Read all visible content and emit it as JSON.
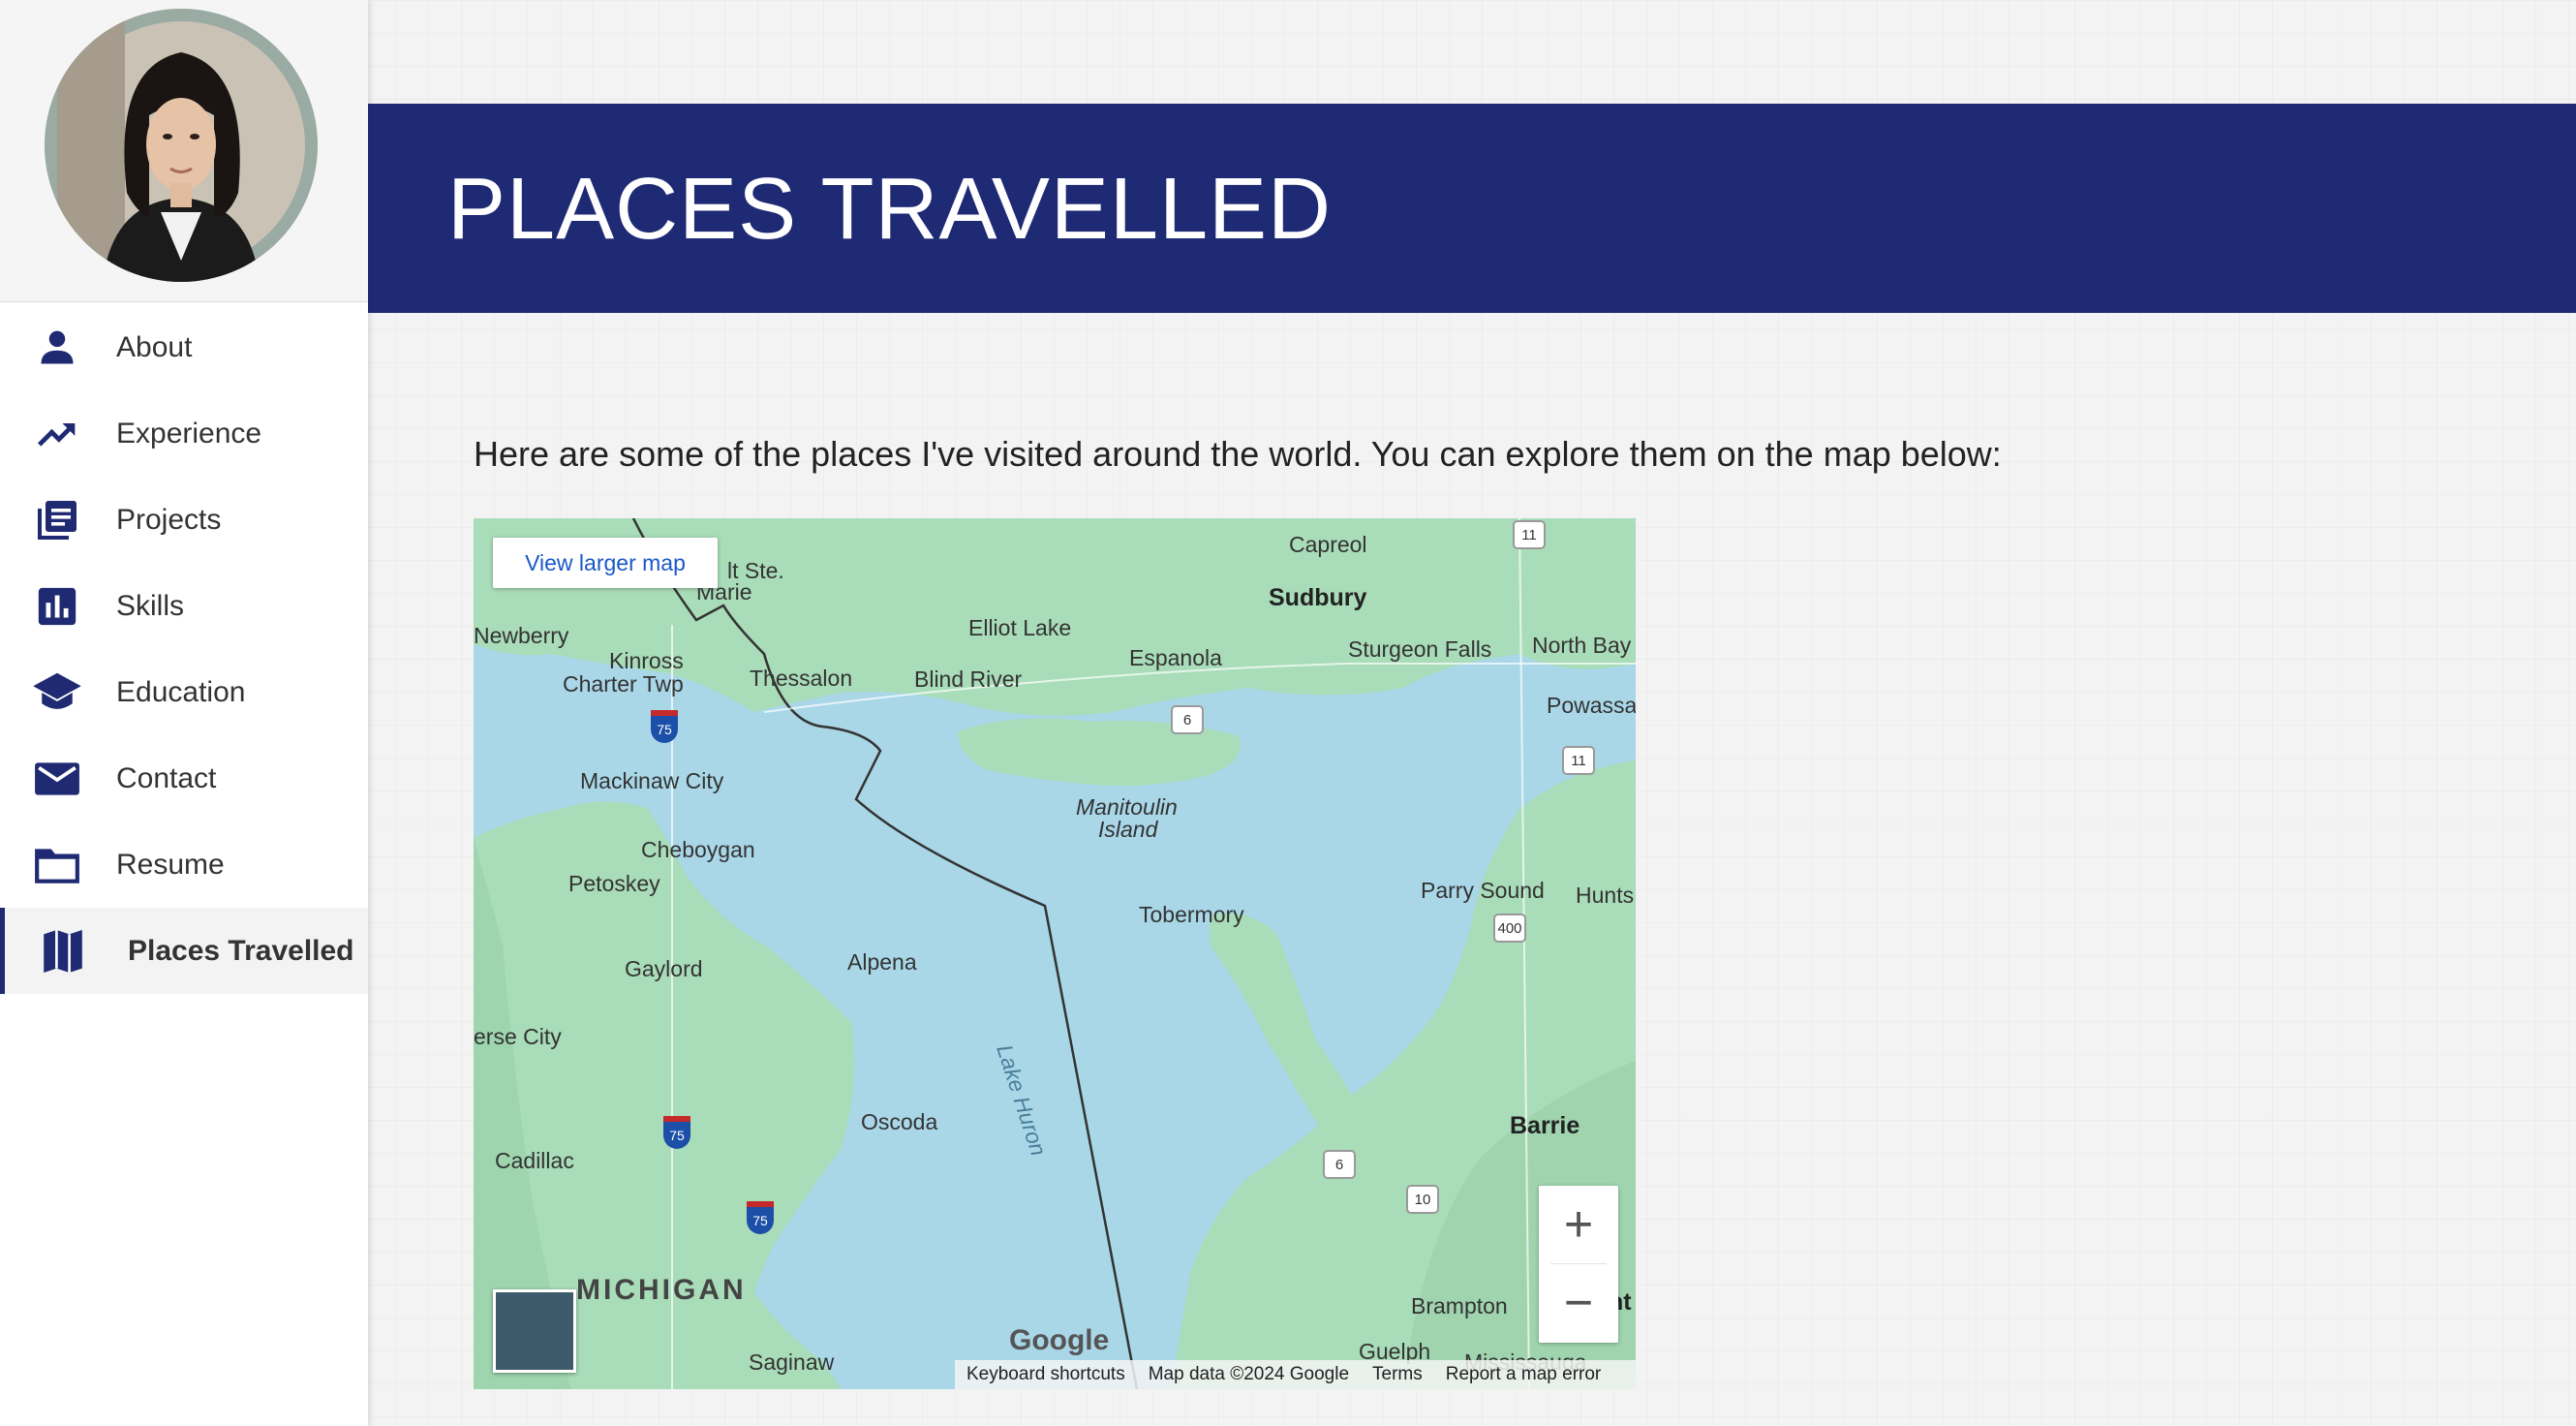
{
  "header": {
    "title": "PLACES TRAVELLED"
  },
  "sidebar": {
    "items": [
      {
        "label": "About",
        "icon": "person-icon"
      },
      {
        "label": "Experience",
        "icon": "trending-up-icon"
      },
      {
        "label": "Projects",
        "icon": "document-stack-icon"
      },
      {
        "label": "Skills",
        "icon": "bar-chart-icon"
      },
      {
        "label": "Education",
        "icon": "graduation-cap-icon"
      },
      {
        "label": "Contact",
        "icon": "mail-icon"
      },
      {
        "label": "Resume",
        "icon": "folder-icon"
      },
      {
        "label": "Places Travelled",
        "icon": "map-icon"
      }
    ],
    "active_index": 7
  },
  "main": {
    "intro": "Here are some of the places I've visited around the world. You can explore them on the map below:"
  },
  "map": {
    "larger_map_label": "View larger map",
    "google_label": "Google",
    "zoom_in": "+",
    "zoom_out": "−",
    "footer": {
      "shortcuts": "Keyboard shortcuts",
      "data": "Map data ©2024 Google",
      "terms": "Terms",
      "report": "Report a map error"
    },
    "labels": {
      "capreol": "Capreol",
      "sudbury": "Sudbury",
      "sault": "lt Ste.",
      "marie": "Marie",
      "newberry": "Newberry",
      "elliot": "Elliot Lake",
      "espanola": "Espanola",
      "north_bay": "North Bay",
      "sturgeon": "Sturgeon Falls",
      "kinross": "Kinross",
      "kinross2": "Charter Twp",
      "thessalon": "Thessalon",
      "blind": "Blind River",
      "powassan": "Powassa",
      "mackinaw": "Mackinaw City",
      "manitoulin": "Manitoulin",
      "island": "Island",
      "cheboygan": "Cheboygan",
      "petoskey": "Petoskey",
      "tobermory": "Tobermory",
      "parry": "Parry Sound",
      "hunts": "Hunts",
      "gaylord": "Gaylord",
      "alpena": "Alpena",
      "traverse": "erse City",
      "lake_huron": "Lake Huron",
      "oscoda": "Oscoda",
      "barrie": "Barrie",
      "cadillac": "Cadillac",
      "michigan": "MICHIGAN",
      "brampton": "Brampton",
      "guelph": "Guelph",
      "mississauga": "Mississauga",
      "saginaw": "Saginaw",
      "nt": "nt"
    },
    "highways": {
      "h11a": "11",
      "h11b": "11",
      "h6a": "6",
      "h6b": "6",
      "h400": "400",
      "h10": "10",
      "i75a": "75",
      "i75b": "75",
      "i75c": "75"
    }
  }
}
